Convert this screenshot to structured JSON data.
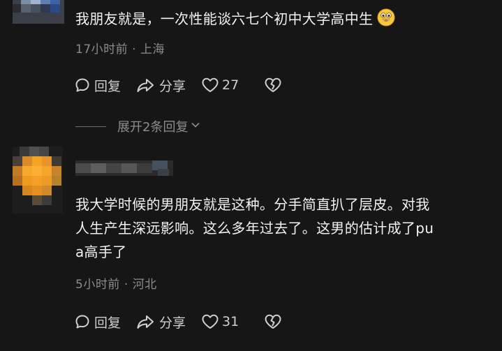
{
  "comments": [
    {
      "text": "我朋友就是，一次性能谈六七个初中大学高中生",
      "emoji": "grinning-emoji",
      "time": "17小时前",
      "location": "上海",
      "reply_label": "回复",
      "share_label": "分享",
      "like_count": "27",
      "expand_label": "展开2条回复"
    },
    {
      "text_lines": [
        "我大学时候的男朋友就是这种。分手简直扒了层皮。对我",
        "人生产生深远影响。这么多年过去了。这男的估计成了pu",
        "a高手了"
      ],
      "time": "5小时前",
      "location": "河北",
      "reply_label": "回复",
      "share_label": "分享",
      "like_count": "31"
    }
  ],
  "separator": "·",
  "colors": {
    "background": "#161616",
    "primary_text": "#f2f2f2",
    "secondary_text": "#8c8c8c",
    "action_text": "#cfcfcf"
  },
  "icons": [
    "reply-icon",
    "share-icon",
    "heart-icon",
    "broken-heart-icon",
    "chevron-down-icon"
  ]
}
